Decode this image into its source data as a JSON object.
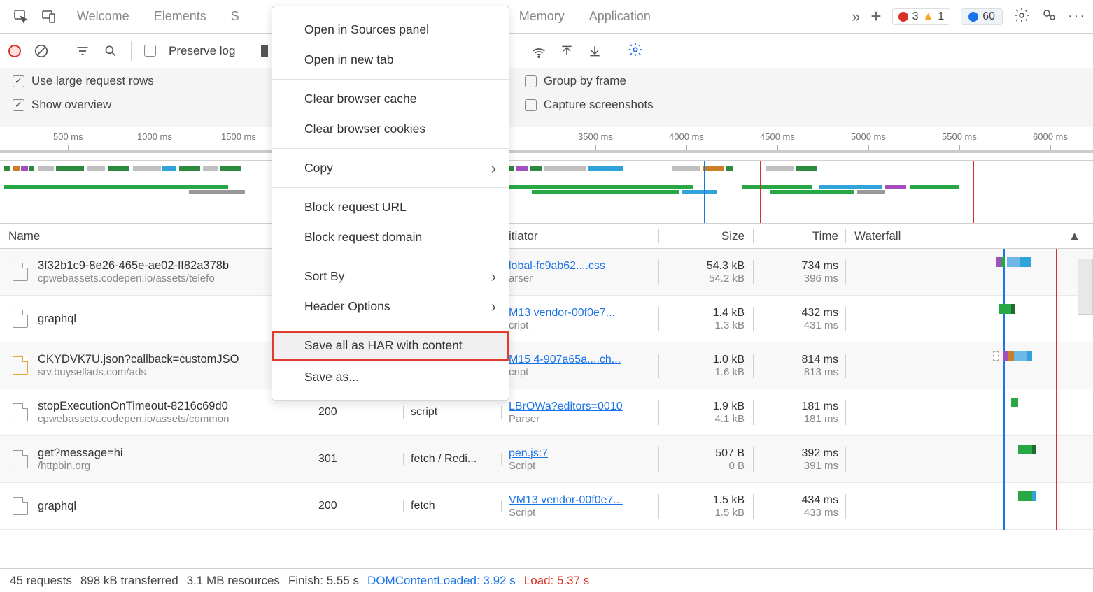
{
  "tabs": {
    "welcome": "Welcome",
    "elements": "Elements",
    "sources_initial": "S",
    "memory": "Memory",
    "application": "Application"
  },
  "badges": {
    "errors": "3",
    "warnings": "1",
    "issues": "60"
  },
  "toolbar": {
    "preserve": "Preserve log"
  },
  "options": {
    "large_rows": "Use large request rows",
    "overview": "Show overview",
    "group_frame": "Group by frame",
    "screenshots": "Capture screenshots"
  },
  "timeline_ticks": [
    "500 ms",
    "1000 ms",
    "1500 ms",
    "3500 ms",
    "4000 ms",
    "4500 ms",
    "5000 ms",
    "5500 ms",
    "6000 ms"
  ],
  "headers": {
    "name": "Name",
    "initiator": "itiator",
    "size": "Size",
    "time": "Time",
    "waterfall": "Waterfall"
  },
  "rows": [
    {
      "name": "3f32b1c9-8e26-465e-ae02-ff82a378b",
      "sub": "cpwebassets.codepen.io/assets/telefo",
      "init": "lobal-fc9ab62....css",
      "initsub": "arser",
      "size": "54.3 kB",
      "size2": "54.2 kB",
      "time": "734 ms",
      "time2": "396 ms"
    },
    {
      "name": "graphql",
      "sub": "",
      "init": "M13 vendor-00f0e7...",
      "initsub": "cript",
      "size": "1.4 kB",
      "size2": "1.3 kB",
      "time": "432 ms",
      "time2": "431 ms"
    },
    {
      "name": "CKYDVK7U.json?callback=customJSO",
      "sub": "srv.buysellads.com/ads",
      "init": "M15 4-907a65a....ch...",
      "initsub": "cript",
      "size": "1.0 kB",
      "size2": "1.6 kB",
      "time": "814 ms",
      "time2": "813 ms",
      "script": true
    },
    {
      "name": "stopExecutionOnTimeout-8216c69d0",
      "sub": "cpwebassets.codepen.io/assets/common",
      "status": "200",
      "type": "script",
      "init": "LBrOWa?editors=0010",
      "initsub": "Parser",
      "size": "1.9 kB",
      "size2": "4.1 kB",
      "time": "181 ms",
      "time2": "181 ms"
    },
    {
      "name": "get?message=hi",
      "sub": "/httpbin.org",
      "status": "301",
      "type": "fetch / Redi...",
      "init": "pen.js:7",
      "initsub": "Script",
      "size": "507 B",
      "size2": "0 B",
      "time": "392 ms",
      "time2": "391 ms"
    },
    {
      "name": "graphql",
      "sub": "",
      "status": "200",
      "type": "fetch",
      "init": "VM13 vendor-00f0e7...",
      "initsub": "Script",
      "size": "1.5 kB",
      "size2": "1.5 kB",
      "time": "434 ms",
      "time2": "433 ms"
    }
  ],
  "context_menu": {
    "open_sources": "Open in Sources panel",
    "open_tab": "Open in new tab",
    "clear_cache": "Clear browser cache",
    "clear_cookies": "Clear browser cookies",
    "copy": "Copy",
    "block_url": "Block request URL",
    "block_domain": "Block request domain",
    "sort": "Sort By",
    "headers": "Header Options",
    "save_har": "Save all as HAR with content",
    "save_as": "Save as..."
  },
  "status_bar": {
    "requests": "45 requests",
    "transferred": "898 kB transferred",
    "resources": "3.1 MB resources",
    "finish": "Finish: 5.55 s",
    "dcl": "DOMContentLoaded: 3.92 s",
    "load": "Load: 5.37 s"
  }
}
